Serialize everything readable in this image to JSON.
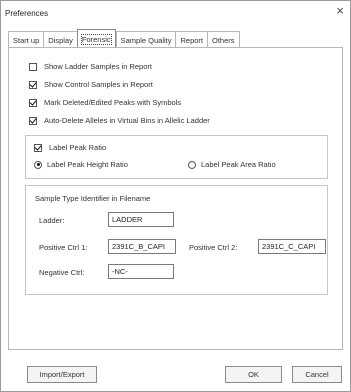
{
  "window": {
    "title": "Preferences",
    "close_symbol": "×"
  },
  "tabs": [
    {
      "label": "Start up"
    },
    {
      "label": "Display"
    },
    {
      "label": "Forensic",
      "active": true
    },
    {
      "label": "Sample Quality"
    },
    {
      "label": "Report"
    },
    {
      "label": "Others"
    }
  ],
  "options": [
    {
      "label": "Show Ladder Samples in Report",
      "checked": false
    },
    {
      "label": "Show Control Samples in Report",
      "checked": true
    },
    {
      "label": "Mark Deleted/Edited Peaks with Symbols",
      "checked": true
    },
    {
      "label": "Auto-Delete Alleles in Virtual Bins in Allelic Ladder",
      "checked": true
    }
  ],
  "peak_group": {
    "checkbox_label": "Label Peak Ratio",
    "checked": true,
    "radio_height": "Label Peak Height Ratio",
    "radio_area": "Label Peak Area Ratio",
    "selected": "height"
  },
  "sample_type_group": {
    "title": "Sample Type Identifier in Filename",
    "ladder_label": "Ladder:",
    "ladder_value": "LADDER",
    "pos1_label": "Positive Ctrl 1:",
    "pos1_value": "2391C_B_CAPI",
    "pos2_label": "Positive Ctrl 2:",
    "pos2_value": "2391C_C_CAPI",
    "neg_label": "Negative Ctrl:",
    "neg_value": "-NC-"
  },
  "buttons": {
    "import_export": "Import/Export",
    "ok": "OK",
    "cancel": "Cancel"
  }
}
